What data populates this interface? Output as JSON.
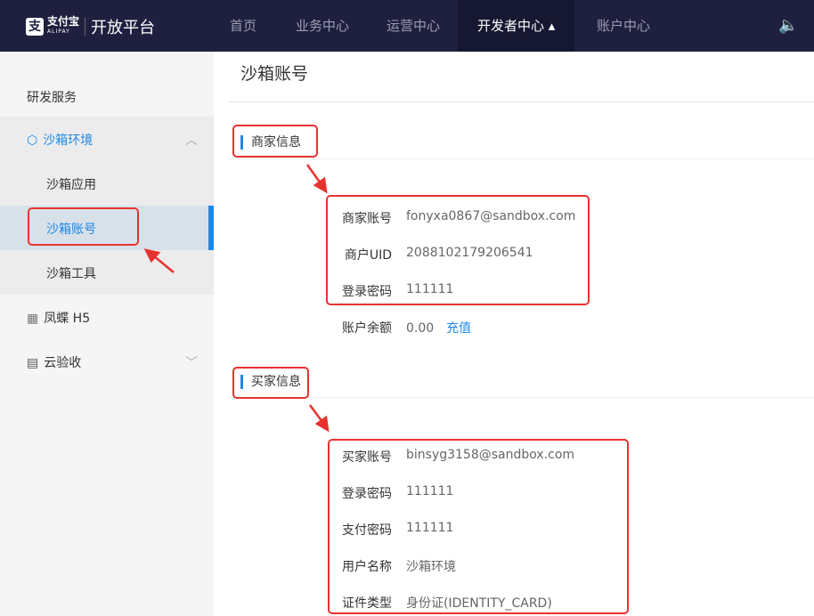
{
  "header": {
    "logo_mark": "支",
    "brand": "支付宝",
    "brand_en": "ALIPAY",
    "platform": "开放平台",
    "nav": [
      "首页",
      "业务中心",
      "运营中心",
      "开发者中心 ▴",
      "账户中心"
    ],
    "speaker_icon": "🔈"
  },
  "sidebar": {
    "section": "研发服务",
    "group": "沙箱环境",
    "items": [
      "沙箱应用",
      "沙箱账号",
      "沙箱工具"
    ],
    "fengdie": "凤蝶 H5",
    "yunyanshou": "云验收"
  },
  "main": {
    "title": "沙箱账号",
    "merchant": {
      "heading": "商家信息",
      "rows": [
        {
          "label": "商家账号",
          "value": "fonyxa0867@sandbox.com"
        },
        {
          "label": "商户UID",
          "value": "2088102179206541"
        },
        {
          "label": "登录密码",
          "value": "111111"
        },
        {
          "label": "账户余额",
          "value": "0.00",
          "action": "充值"
        }
      ]
    },
    "buyer": {
      "heading": "买家信息",
      "rows": [
        {
          "label": "买家账号",
          "value": "binsyg3158@sandbox.com"
        },
        {
          "label": "登录密码",
          "value": "111111"
        },
        {
          "label": "支付密码",
          "value": "111111"
        },
        {
          "label": "用户名称",
          "value": "沙箱环境"
        },
        {
          "label": "证件类型",
          "value": "身份证(IDENTITY_CARD)"
        }
      ]
    }
  }
}
